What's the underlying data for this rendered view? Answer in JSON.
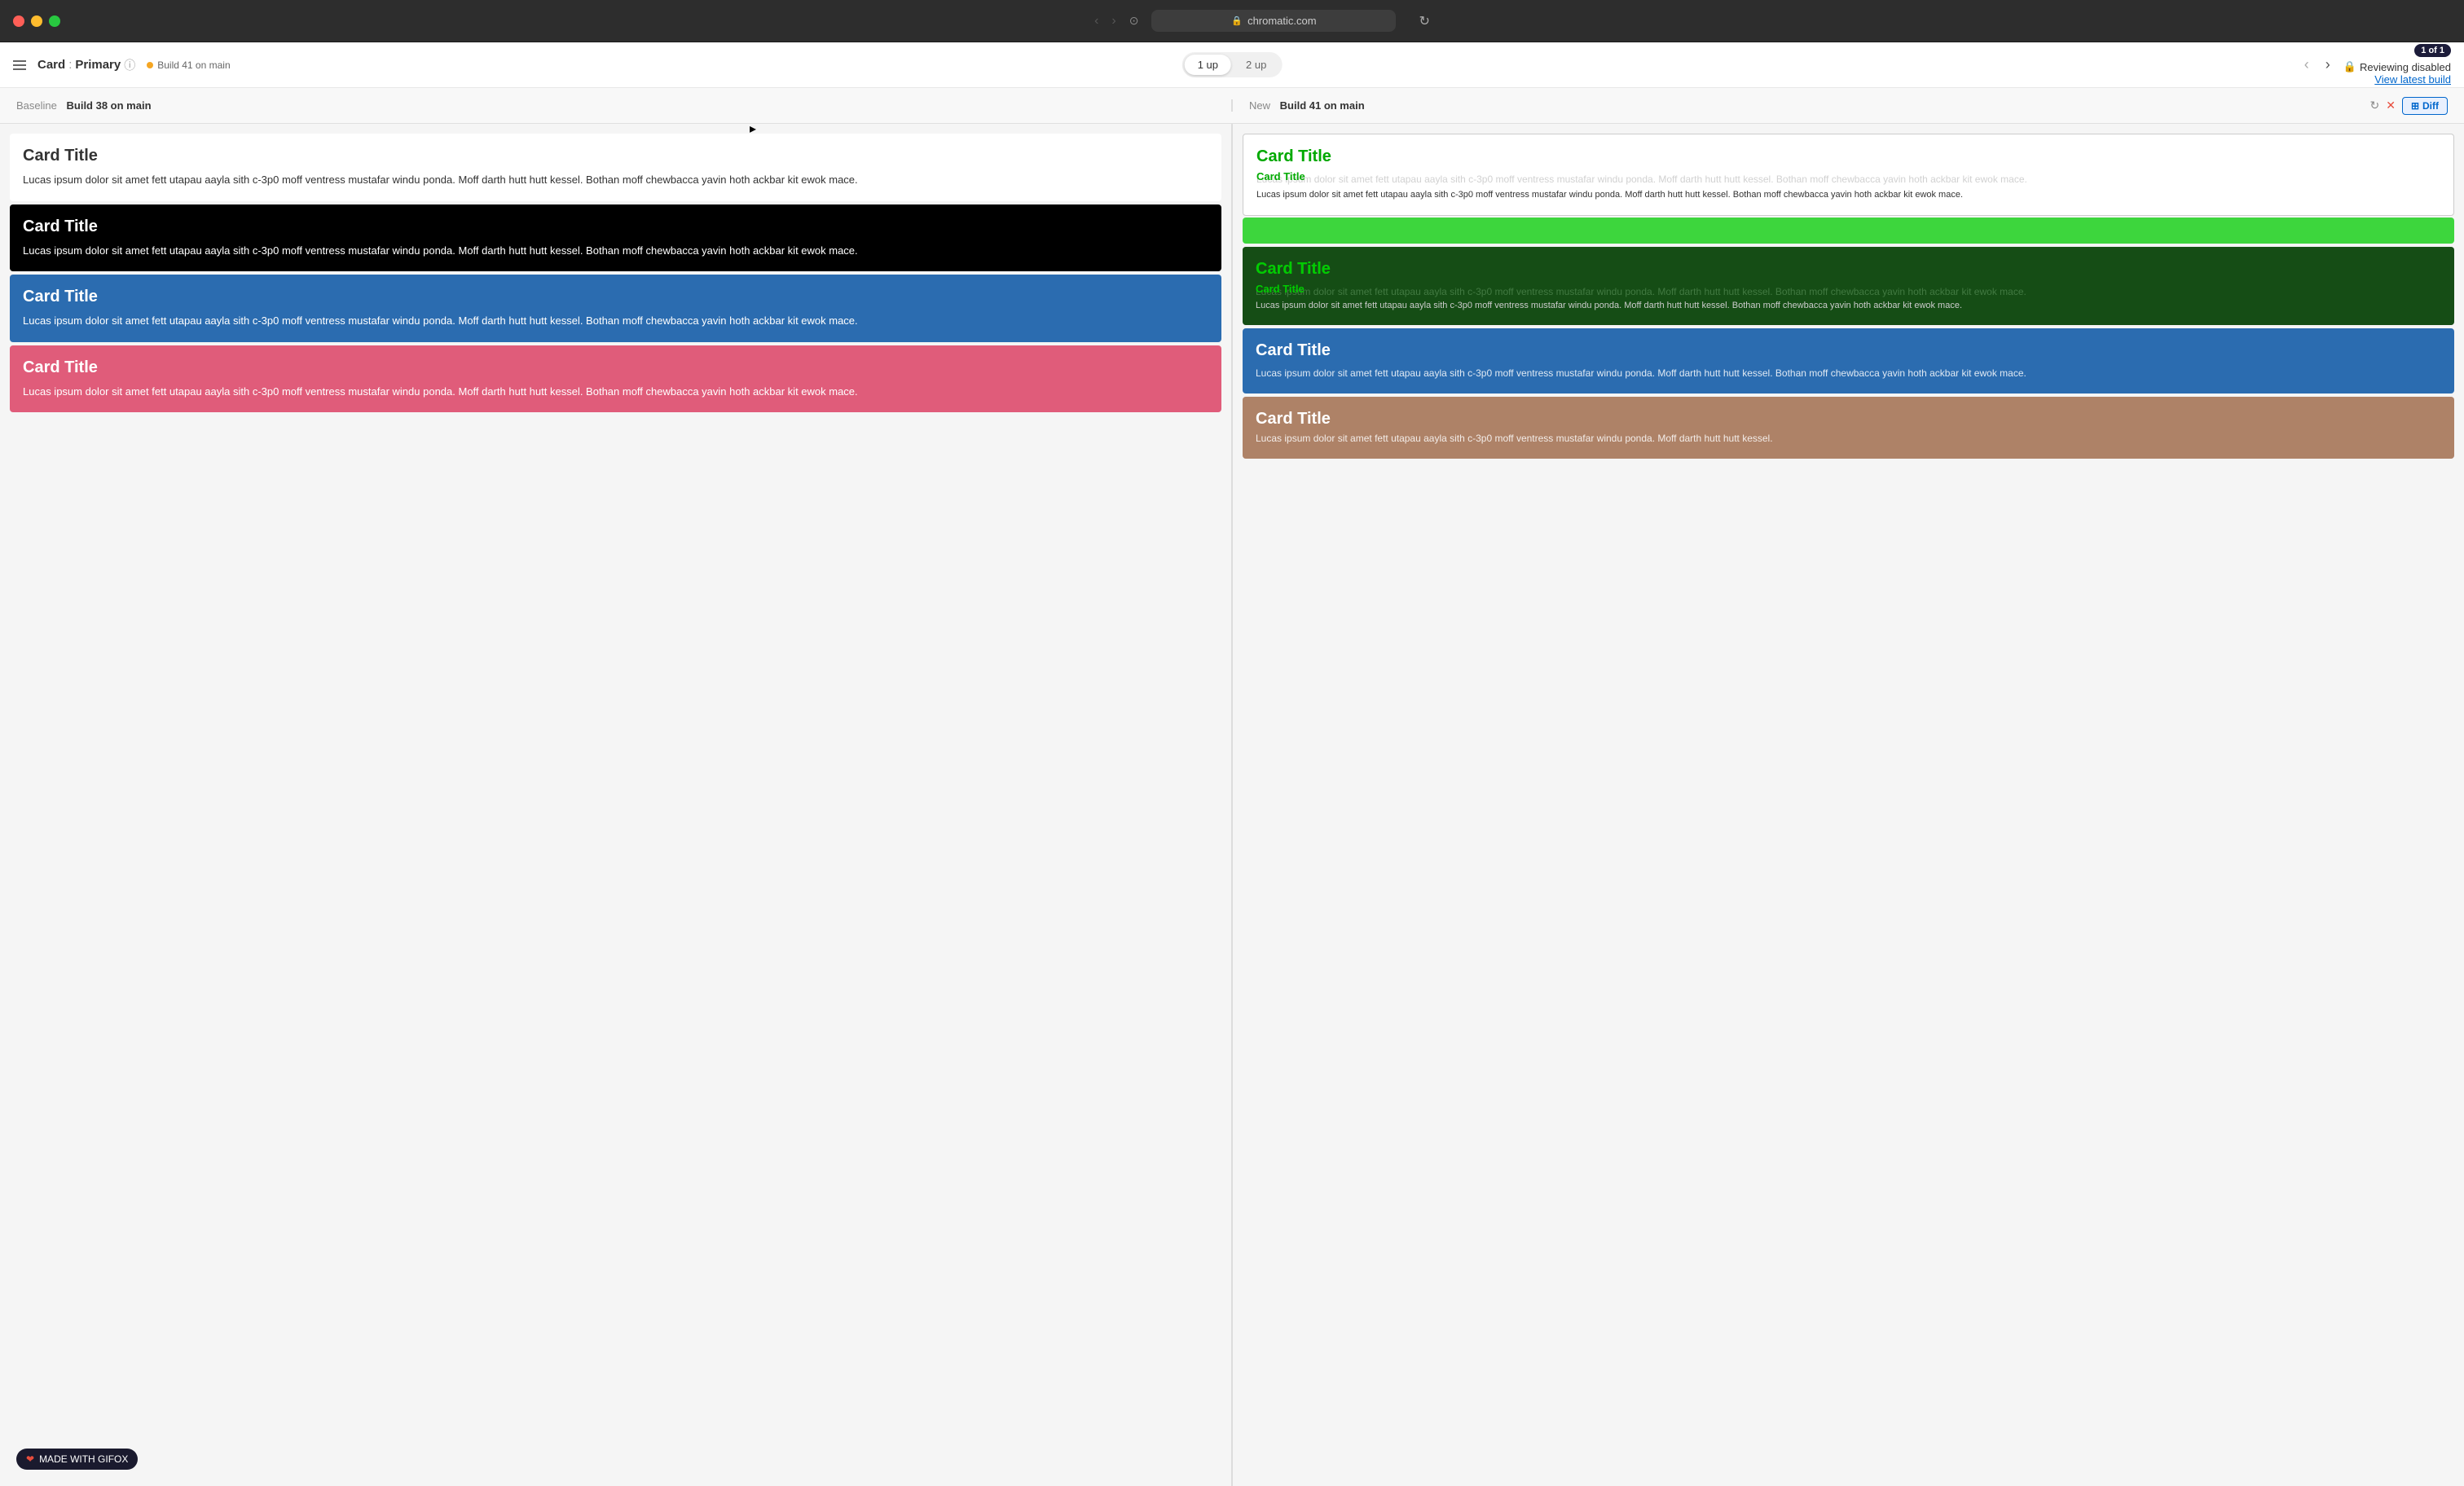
{
  "browser": {
    "url": "chromatic.com",
    "back_btn": "‹",
    "fwd_btn": "›",
    "history_icon": "⊙",
    "reload_icon": "↻"
  },
  "header": {
    "card_label": "Card",
    "separator": ":",
    "primary_label": "Primary",
    "info_icon": "ⓘ",
    "build_label": "Build 41 on main",
    "toggle_1up": "1 up",
    "toggle_2up": "2 up",
    "nav_prev": "‹",
    "nav_next": "›",
    "page_count": "1 of 1",
    "lock_icon": "🔒",
    "reviewing_disabled": "Reviewing disabled",
    "view_latest": "View latest build"
  },
  "comparison": {
    "baseline_label": "Baseline",
    "baseline_build": "Build 38 on main",
    "new_label": "New",
    "new_build": "Build 41 on main",
    "diff_btn": "Diff",
    "diff_icon": "⊞"
  },
  "cards": {
    "title": "Card Title",
    "body": "Lucas ipsum dolor sit amet fett utapau aayla sith c-3p0 moff ventress mustafar windu ponda. Moff darth hutt hutt kessel. Bothan moff chewbacca yavin hoth ackbar kit ewok mace."
  },
  "gifox": {
    "label": "MADE WITH GIFOX",
    "heart": "❤"
  }
}
